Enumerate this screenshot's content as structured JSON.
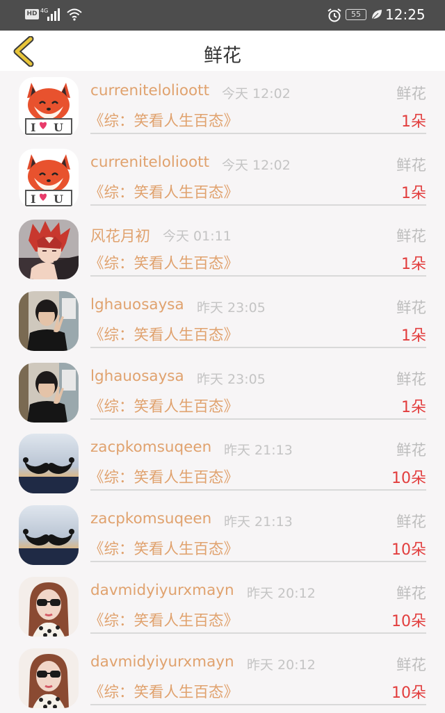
{
  "status_bar": {
    "network_badge": "HD",
    "network_type": "4G",
    "battery_level": "55",
    "time": "12:25",
    "icons": [
      "signal-icon",
      "wifi-icon",
      "alarm-icon",
      "battery-icon",
      "eco-leaf-icon"
    ]
  },
  "header": {
    "title": "鲜花",
    "back_icon": "chevron-left-icon"
  },
  "records": [
    {
      "user": "currenitelolioott",
      "time": "今天 12:02",
      "gift": "鲜花",
      "book": "《综：笑看人生百态》",
      "count": "1朵",
      "avatar": "fox-i-love-u"
    },
    {
      "user": "currenitelolioott",
      "time": "今天 12:02",
      "gift": "鲜花",
      "book": "《综：笑看人生百态》",
      "count": "1朵",
      "avatar": "fox-i-love-u"
    },
    {
      "user": "风花月初",
      "time": "今天 01:11",
      "gift": "鲜花",
      "book": "《综：笑看人生百态》",
      "count": "1朵",
      "avatar": "anime-red-hair"
    },
    {
      "user": "lghauosaysa",
      "time": "昨天 23:05",
      "gift": "鲜花",
      "book": "《综：笑看人生百态》",
      "count": "1朵",
      "avatar": "man-peace-sign"
    },
    {
      "user": "lghauosaysa",
      "time": "昨天 23:05",
      "gift": "鲜花",
      "book": "《综：笑看人生百态》",
      "count": "1朵",
      "avatar": "man-peace-sign"
    },
    {
      "user": "zacpkomsuqeen",
      "time": "昨天 21:13",
      "gift": "鲜花",
      "book": "《综：笑看人生百态》",
      "count": "10朵",
      "avatar": "mustache-sunset"
    },
    {
      "user": "zacpkomsuqeen",
      "time": "昨天 21:13",
      "gift": "鲜花",
      "book": "《综：笑看人生百态》",
      "count": "10朵",
      "avatar": "mustache-sunset"
    },
    {
      "user": "davmidyiyurxmayn",
      "time": "昨天 20:12",
      "gift": "鲜花",
      "book": "《综：笑看人生百态》",
      "count": "10朵",
      "avatar": "woman-sunglasses"
    },
    {
      "user": "davmidyiyurxmayn",
      "time": "昨天 20:12",
      "gift": "鲜花",
      "book": "《综：笑看人生百态》",
      "count": "10朵",
      "avatar": "woman-sunglasses"
    }
  ],
  "colors": {
    "username": "#e0a26e",
    "count": "#e23d3d",
    "muted": "#c4c4c4",
    "accent_back": "#e8c53a"
  }
}
